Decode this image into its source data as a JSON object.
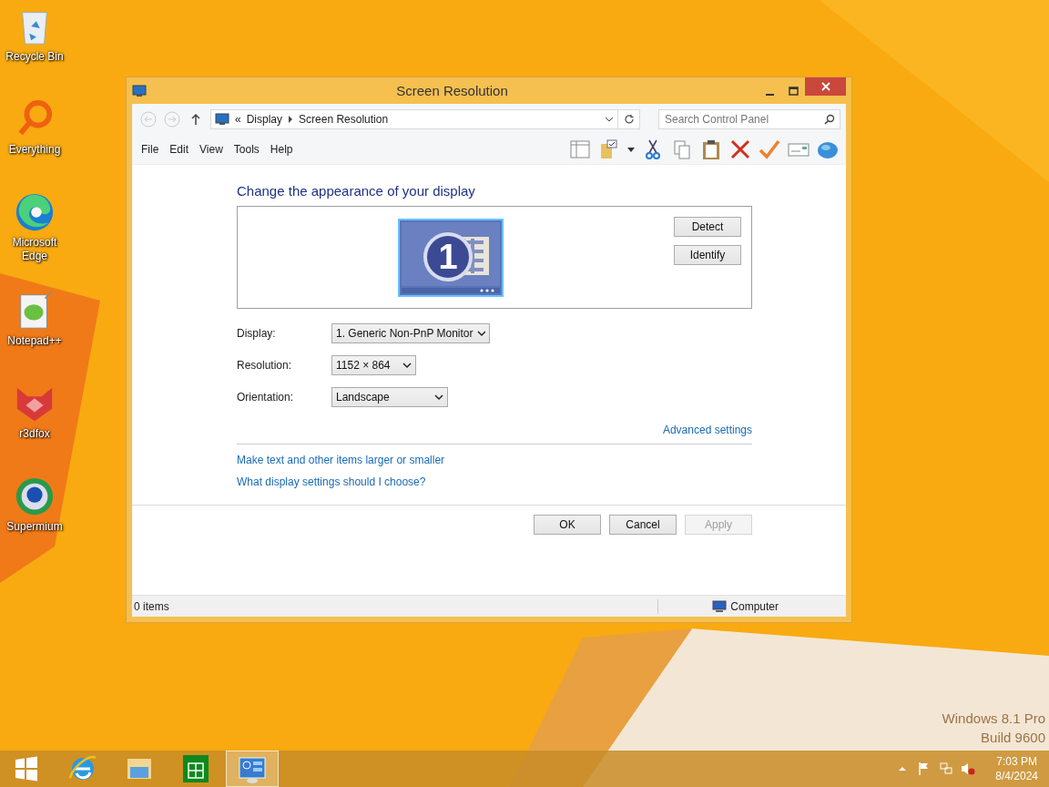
{
  "desktop_icons": [
    {
      "label": "Recycle Bin",
      "kind": "recycle"
    },
    {
      "label": "Everything",
      "kind": "everything"
    },
    {
      "label": "Microsoft Edge",
      "kind": "edge"
    },
    {
      "label": "Notepad++",
      "kind": "notepad"
    },
    {
      "label": "r3dfox",
      "kind": "fox"
    },
    {
      "label": "Supermium",
      "kind": "browser"
    }
  ],
  "window": {
    "title": "Screen Resolution",
    "address": {
      "prefix": "«",
      "path": [
        "Display",
        "Screen Resolution"
      ]
    },
    "search": {
      "placeholder": "Search Control Panel"
    },
    "menu": [
      "File",
      "Edit",
      "View",
      "Tools",
      "Help"
    ],
    "content": {
      "heading": "Change the appearance of your display",
      "monitor_number": "1",
      "panel_buttons": [
        "Detect",
        "Identify"
      ],
      "fields": [
        {
          "label": "Display:",
          "value": "1. Generic Non-PnP Monitor"
        },
        {
          "label": "Resolution:",
          "value": "1152 × 864"
        },
        {
          "label": "Orientation:",
          "value": "Landscape"
        }
      ],
      "advanced_link": "Advanced settings",
      "links": [
        "Make text and other items larger or smaller",
        "What display settings should I choose?"
      ],
      "buttons": [
        {
          "label": "OK",
          "disabled": false
        },
        {
          "label": "Cancel",
          "disabled": false
        },
        {
          "label": "Apply",
          "disabled": true
        }
      ]
    },
    "status_bar": {
      "items": "0 items",
      "location": "Computer"
    }
  },
  "watermark": [
    "Windows 8.1 Pro",
    "Build 9600"
  ],
  "taskbar": {
    "apps": [
      {
        "kind": "start",
        "selected": false
      },
      {
        "kind": "ie",
        "selected": false
      },
      {
        "kind": "explorer",
        "selected": false
      },
      {
        "kind": "store",
        "selected": false
      },
      {
        "kind": "control",
        "selected": true
      }
    ],
    "clock": {
      "time": "7:03 PM",
      "date": "8/4/2024"
    }
  }
}
